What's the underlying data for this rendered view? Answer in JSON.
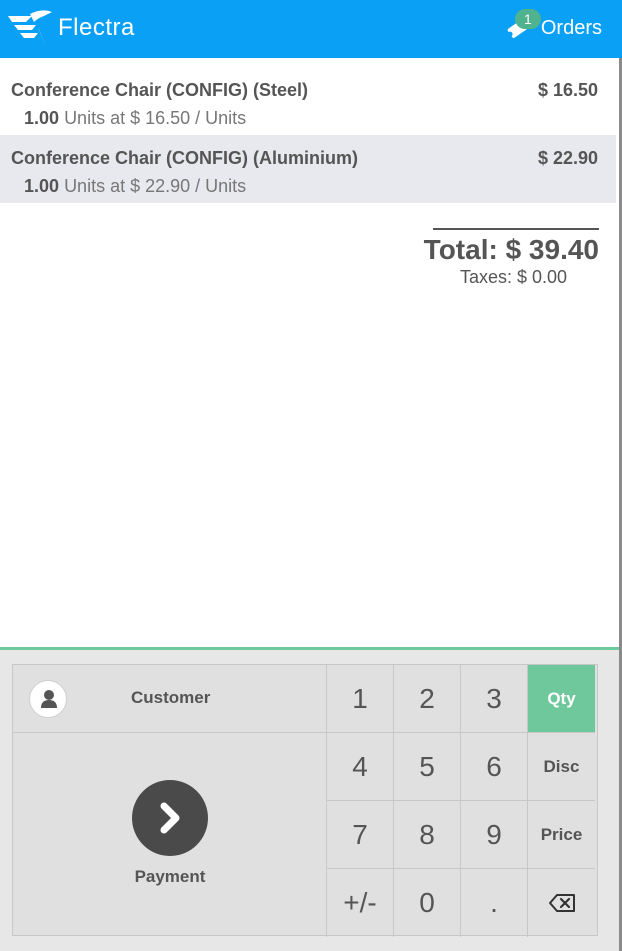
{
  "header": {
    "brand": "Flectra",
    "orders_label": "Orders",
    "orders_badge": "1",
    "colors": {
      "bar": "#0aa0f5",
      "badge": "#4fb38f"
    }
  },
  "order_lines": [
    {
      "name": "Conference Chair (CONFIG) (Steel)",
      "price": "$ 16.50",
      "qty": "1.00",
      "unit_info": "Units at $ 16.50 / Units",
      "selected": false
    },
    {
      "name": "Conference Chair (CONFIG) (Aluminium)",
      "price": "$ 22.90",
      "qty": "1.00",
      "unit_info": "Units at $ 22.90 / Units",
      "selected": true
    }
  ],
  "summary": {
    "total": "Total: $ 39.40",
    "taxes": "Taxes: $ 0.00"
  },
  "actionpad": {
    "customer_label": "Customer",
    "payment_label": "Payment"
  },
  "numpad": {
    "keys": [
      "1",
      "2",
      "3",
      "4",
      "5",
      "6",
      "7",
      "8",
      "9",
      "+/-",
      "0",
      "."
    ],
    "modes": [
      "Qty",
      "Disc",
      "Price"
    ],
    "active_mode": "Qty",
    "accent_color": "#6ec89b",
    "backspace_icon": "backspace-icon"
  }
}
